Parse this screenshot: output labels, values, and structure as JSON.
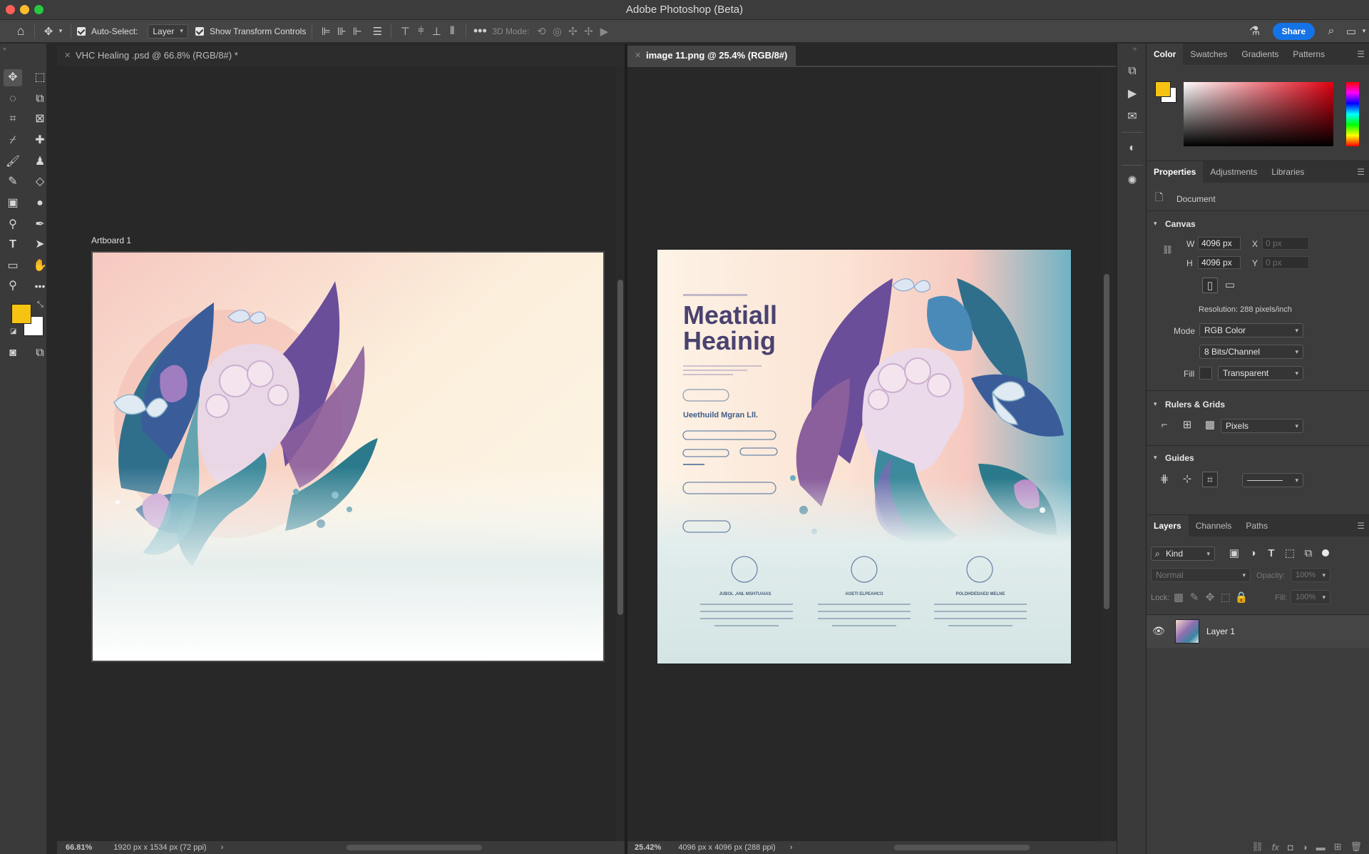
{
  "window": {
    "title": "Adobe Photoshop (Beta)",
    "traffic": [
      "#fe5f57",
      "#febc2e",
      "#28c840"
    ]
  },
  "options": {
    "auto_select_label": "Auto-Select:",
    "auto_select_value": "Layer",
    "show_transform_label": "Show Transform Controls",
    "three_d_label": "3D Mode:",
    "share_label": "Share"
  },
  "docs": [
    {
      "tab_label": "VHC Healing .psd @ 66.8% (RGB/8#) *",
      "artboard_label": "Artboard 1",
      "zoom": "66.81%",
      "status": "1920 px x 1534 px (72 ppi)"
    },
    {
      "tab_label": "image 11.png @ 25.4% (RGB/8#)",
      "zoom": "25.42%",
      "status": "4096 px x 4096 px (288 ppi)"
    }
  ],
  "mockup": {
    "title_line1": "Meatiall",
    "title_line2": "Heainig",
    "pill_text": "Ueethuild Mgran Lll.",
    "features": [
      "JUBOL ,ANL MSHTUAIAS",
      "AOETI ELPEAHCO",
      "POLDHDEDAED MELNE"
    ]
  },
  "color_panel": {
    "tabs": [
      "Color",
      "Swatches",
      "Gradients",
      "Patterns"
    ],
    "foreground": "#f7c312",
    "background": "#ffffff"
  },
  "properties": {
    "tabs": [
      "Properties",
      "Adjustments",
      "Libraries"
    ],
    "doc_label": "Document",
    "canvas": {
      "title": "Canvas",
      "w_label": "W",
      "w_value": "4096 px",
      "h_label": "H",
      "h_value": "4096 px",
      "x_label": "X",
      "x_value": "0 px",
      "y_label": "Y",
      "y_value": "0 px",
      "resolution": "Resolution: 288 pixels/inch",
      "mode_label": "Mode",
      "mode_value": "RGB Color",
      "bits_value": "8 Bits/Channel",
      "fill_label": "Fill",
      "fill_value": "Transparent"
    },
    "rulers": {
      "title": "Rulers & Grids",
      "unit": "Pixels"
    },
    "guides": {
      "title": "Guides"
    }
  },
  "layers": {
    "tabs": [
      "Layers",
      "Channels",
      "Paths"
    ],
    "kind_label": "Kind",
    "blend_mode": "Normal",
    "opacity_label": "Opacity:",
    "opacity_value": "100%",
    "lock_label": "Lock:",
    "fill_label": "Fill:",
    "fill_value": "100%",
    "items": [
      {
        "name": "Layer 1",
        "visible": true
      }
    ]
  }
}
